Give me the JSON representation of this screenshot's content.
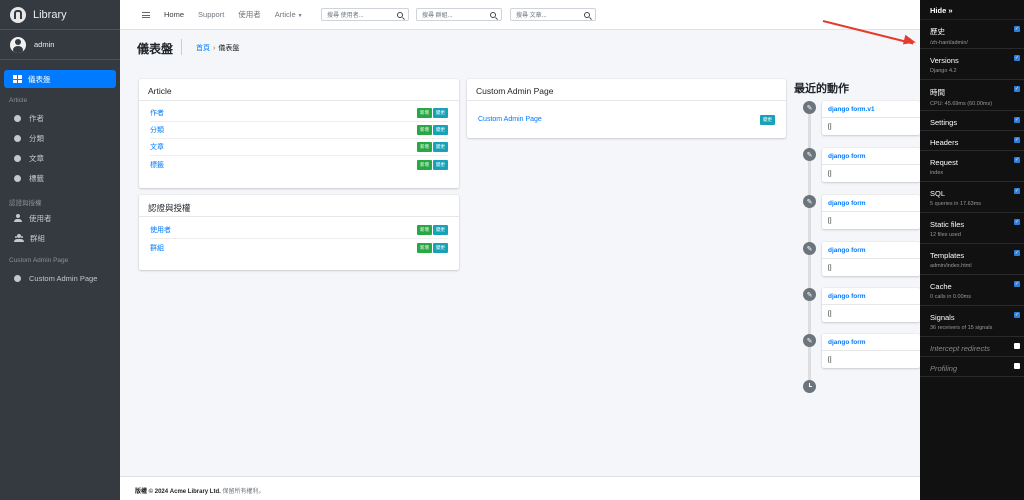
{
  "brand": {
    "name": "Library"
  },
  "user": {
    "name": "admin"
  },
  "sidebar": {
    "active": "儀表盤",
    "sections": [
      {
        "header": "Article",
        "items": [
          "作者",
          "分類",
          "文章",
          "標籤"
        ]
      },
      {
        "header": "認證與授權",
        "items": [
          "使用者",
          "群組"
        ]
      },
      {
        "header": "Custom Admin Page",
        "items": [
          "Custom Admin Page"
        ]
      }
    ]
  },
  "topbar": {
    "home": "Home",
    "support": "Support",
    "users": "使用者",
    "article": "Article",
    "search_users_placeholder": "搜尋 使用者...",
    "search_groups_placeholder": "搜尋 群組...",
    "search_articles_placeholder": "搜尋 文章..."
  },
  "header": {
    "title": "儀表盤",
    "breadcrumb_home": "首頁",
    "breadcrumb_current": "儀表盤"
  },
  "article_card": {
    "title": "Article",
    "rows": [
      {
        "name": "作者",
        "add": "新增",
        "change": "變更"
      },
      {
        "name": "分類",
        "add": "新增",
        "change": "變更"
      },
      {
        "name": "文章",
        "add": "新增",
        "change": "變更"
      },
      {
        "name": "標籤",
        "add": "新增",
        "change": "變更"
      }
    ]
  },
  "auth_card": {
    "title": "認證與授權",
    "rows": [
      {
        "name": "使用者",
        "add": "新增",
        "change": "變更"
      },
      {
        "name": "群組",
        "add": "新增",
        "change": "變更"
      }
    ]
  },
  "custom_card": {
    "title": "Custom Admin Page",
    "rows": [
      {
        "name": "Custom Admin Page",
        "change": "變更"
      }
    ]
  },
  "recent_actions": {
    "title": "最近的動作",
    "items": [
      {
        "object": "django form.v1",
        "detail": "[]"
      },
      {
        "object": "django form",
        "detail": "[]"
      },
      {
        "object": "django form",
        "detail": "[]"
      },
      {
        "object": "django form",
        "detail": "[]"
      },
      {
        "object": "django form",
        "detail": "[]"
      },
      {
        "object": "django form",
        "detail": "[]"
      }
    ]
  },
  "footer": {
    "copyright": "版權 © 2024 Acme Library Ltd.",
    "rights": "保留所有權利。"
  },
  "debug_toolbar": {
    "hide": "Hide »",
    "panels": [
      {
        "name": "歷史",
        "sub": "/zh-hant/admin/",
        "checked": true
      },
      {
        "name": "Versions",
        "sub": "Django 4.2",
        "checked": true
      },
      {
        "name": "時間",
        "sub": "CPU: 45.69ms (60.00ms)",
        "checked": true
      },
      {
        "name": "Settings",
        "sub": "",
        "checked": true
      },
      {
        "name": "Headers",
        "sub": "",
        "checked": true
      },
      {
        "name": "Request",
        "sub": "index",
        "checked": true
      },
      {
        "name": "SQL",
        "sub": "5 queries in 17.63ms",
        "checked": true
      },
      {
        "name": "Static files",
        "sub": "12 files used",
        "checked": true
      },
      {
        "name": "Templates",
        "sub": "admin/index.html",
        "checked": true
      },
      {
        "name": "Cache",
        "sub": "0 calls in 0.00ms",
        "checked": true
      },
      {
        "name": "Signals",
        "sub": "36 receivers of 15 signals",
        "checked": true
      },
      {
        "name": "Intercept redirects",
        "sub": "",
        "checked": false
      },
      {
        "name": "Profiling",
        "sub": "",
        "checked": false
      }
    ]
  },
  "colors": {
    "primary": "#007bff",
    "success": "#28a745",
    "info": "#17a2b8",
    "sidebar": "#343a40",
    "annotation_arrow": "#e53b2c"
  },
  "icons": [
    "brand-logo-icon",
    "user-avatar-icon",
    "dashboard-grid-icon",
    "circle-icon",
    "user-icon",
    "users-icon",
    "menu-icon",
    "search-icon",
    "edit-icon",
    "clock-icon",
    "checkbox-icon"
  ]
}
